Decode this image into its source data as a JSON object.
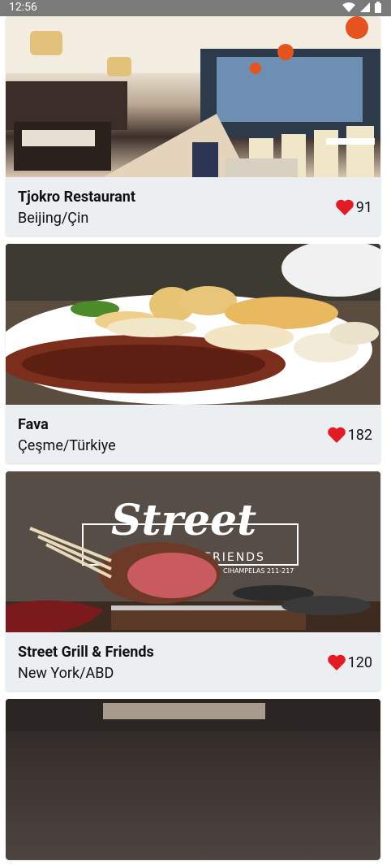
{
  "status_bar": {
    "time": "12:56"
  },
  "restaurants": [
    {
      "name": "Tjokro Restaurant",
      "location": "Beijing/Çin",
      "likes": "91"
    },
    {
      "name": "Fava",
      "location": "Çeşme/Türkiye",
      "likes": "182"
    },
    {
      "name": "Street Grill & Friends",
      "location": "New York/ABD",
      "likes": "120"
    }
  ],
  "street_logo": {
    "title": "Street",
    "subtitle": "FRIENDS",
    "address": "CIHAMPELAS 211-217"
  },
  "colors": {
    "heart": "#e31b23",
    "card_bg": "#eceff1",
    "status_bar": "#7a7a7a"
  },
  "icons": {
    "like": "heart-icon",
    "wifi": "wifi-icon",
    "signal": "signal-icon",
    "battery": "battery-icon"
  }
}
